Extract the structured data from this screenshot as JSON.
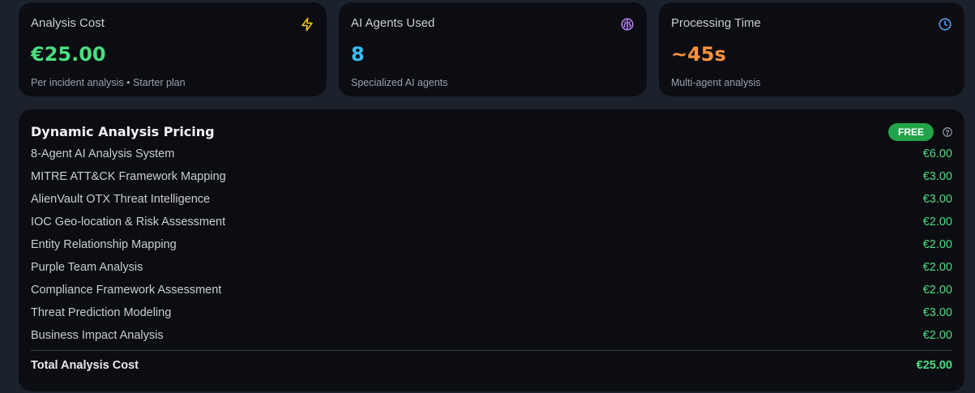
{
  "stats": [
    {
      "label": "Analysis Cost",
      "value": "€25.00",
      "subtitle": "Per incident analysis • Starter plan",
      "icon": "lightning-icon",
      "value_color": "#4ade80",
      "icon_color": "#facc15"
    },
    {
      "label": "AI Agents Used",
      "value": "8",
      "subtitle": "Specialized AI agents",
      "icon": "brain-icon",
      "value_color": "#38bdf8",
      "icon_color": "#c084fc"
    },
    {
      "label": "Processing Time",
      "value": "~45s",
      "subtitle": "Multi-agent analysis",
      "icon": "clock-icon",
      "value_color": "#fb923c",
      "icon_color": "#60a5fa"
    }
  ],
  "pricing": {
    "title": "Dynamic Analysis Pricing",
    "badge": "FREE",
    "badge_color": "#22a34a",
    "help_icon": "help-circle-icon",
    "items": [
      {
        "name": "8-Agent AI Analysis System",
        "price": "€6.00"
      },
      {
        "name": "MITRE ATT&CK Framework Mapping",
        "price": "€3.00"
      },
      {
        "name": "AlienVault OTX Threat Intelligence",
        "price": "€3.00"
      },
      {
        "name": "IOC Geo-location & Risk Assessment",
        "price": "€2.00"
      },
      {
        "name": "Entity Relationship Mapping",
        "price": "€2.00"
      },
      {
        "name": "Purple Team Analysis",
        "price": "€2.00"
      },
      {
        "name": "Compliance Framework Assessment",
        "price": "€2.00"
      },
      {
        "name": "Threat Prediction Modeling",
        "price": "€3.00"
      },
      {
        "name": "Business Impact Analysis",
        "price": "€2.00"
      }
    ],
    "total_label": "Total Analysis Cost",
    "total_value": "€25.00"
  }
}
